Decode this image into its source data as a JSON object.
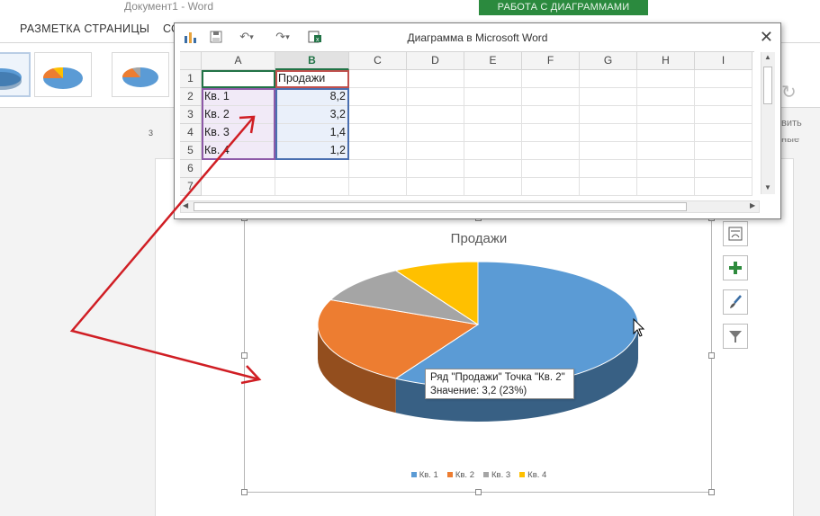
{
  "word": {
    "title": "Документ1 - Word",
    "context_tab": "РАБОТА С ДИАГРАММАМИ",
    "ribbon_tabs": [
      "РАЗМЕТКА СТРАНИЦЫ",
      "СС"
    ],
    "ribbon_right_lines": [
      "вить",
      "ные"
    ],
    "ruler_mark": "3"
  },
  "excel_window": {
    "title": "Диаграмма в Microsoft Word",
    "close_glyph": "✕",
    "column_headers": [
      "A",
      "B",
      "C",
      "D",
      "E",
      "F",
      "G",
      "H",
      "I"
    ],
    "row_headers": [
      "1",
      "2",
      "3",
      "4",
      "5",
      "6",
      "7"
    ],
    "header_cell": "Продажи",
    "rows": [
      {
        "label": "Кв. 1",
        "value": "8,2"
      },
      {
        "label": "Кв. 2",
        "value": "3,2"
      },
      {
        "label": "Кв. 3",
        "value": "1,4"
      },
      {
        "label": "Кв. 4",
        "value": "1,2"
      }
    ]
  },
  "tooltip": {
    "line1": "Ряд \"Продажи\" Точка \"Кв. 2\"",
    "line2": "Значение: 3,2 (23%)"
  },
  "side_buttons": [
    {
      "icon": "chart-layout-icon"
    },
    {
      "icon": "plus-icon"
    },
    {
      "icon": "brush-icon"
    },
    {
      "icon": "filter-icon"
    }
  ],
  "chart_data": {
    "type": "pie",
    "title": "Продажи",
    "categories": [
      "Кв. 1",
      "Кв. 2",
      "Кв. 3",
      "Кв. 4"
    ],
    "values": [
      8.2,
      3.2,
      1.4,
      1.2
    ],
    "colors": [
      "#5b9bd5",
      "#ed7d31",
      "#a5a5a5",
      "#ffc000"
    ],
    "style": "3d",
    "legend_position": "bottom"
  }
}
